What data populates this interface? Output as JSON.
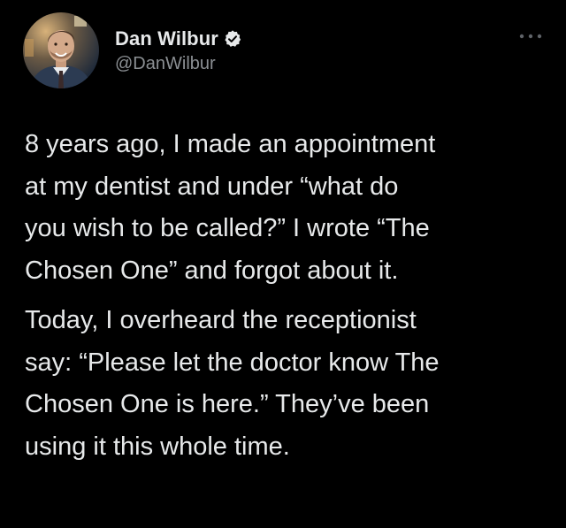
{
  "tweet": {
    "author": {
      "display_name": "Dan Wilbur",
      "handle": "@DanWilbur",
      "verified": true,
      "avatar_icon": "avatar-photo"
    },
    "more_icon": "more-horizontal-icon",
    "paragraphs": [
      "8 years ago, I made an appointment\nat my dentist and under “what do\nyou wish to be called?” I wrote “The\nChosen One” and forgot about it.",
      "Today, I overheard the receptionist\nsay: “Please let the doctor know The\nChosen One is here.” They’ve been\nusing it this whole time."
    ]
  },
  "colors": {
    "background": "#000000",
    "primary_text": "#e7e9ea",
    "secondary_text": "#8b8f93",
    "verified_badge": "#e7e9ea"
  }
}
